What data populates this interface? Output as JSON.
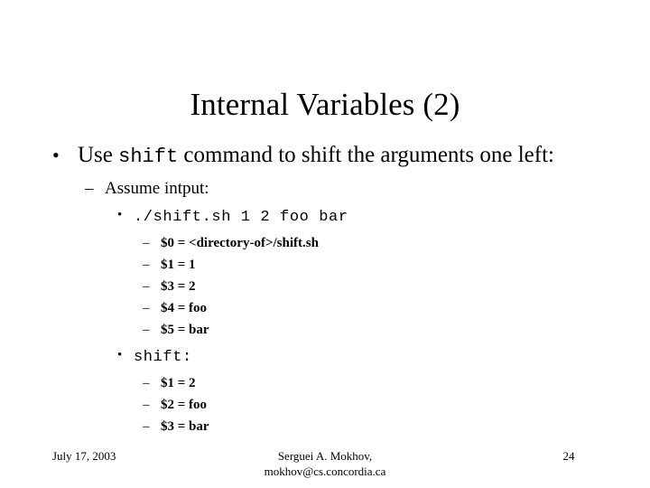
{
  "slide": {
    "title": "Internal Variables (2)",
    "background_color": "#ffffff",
    "text_color": "#000000"
  },
  "content": {
    "bullet1": {
      "marker": "•",
      "part1": "Use ",
      "code": "shift",
      "part2": " command to shift the arguments one left:"
    },
    "assume": {
      "marker": "–",
      "text": "Assume intput:"
    },
    "command": {
      "marker": "•",
      "code": "./shift.sh 1 2 foo bar"
    },
    "before_shift_vars": [
      {
        "marker": "–",
        "text": "$0 = <directory-of>/shift.sh"
      },
      {
        "marker": "–",
        "text": "$1 = 1"
      },
      {
        "marker": "–",
        "text": "$3 = 2"
      },
      {
        "marker": "–",
        "text": "$4 = foo"
      },
      {
        "marker": "–",
        "text": "$5 = bar"
      }
    ],
    "shift_label": {
      "marker": "•",
      "code": "shift:"
    },
    "after_shift_vars": [
      {
        "marker": "–",
        "text": "$1 = 2"
      },
      {
        "marker": "–",
        "text": "$2 = foo"
      },
      {
        "marker": "–",
        "text": "$3 = bar"
      }
    ]
  },
  "footer": {
    "date": "July 17, 2003",
    "author": "Serguei A. Mokhov,",
    "email": "mokhov@cs.concordia.ca",
    "page_number": "24"
  }
}
